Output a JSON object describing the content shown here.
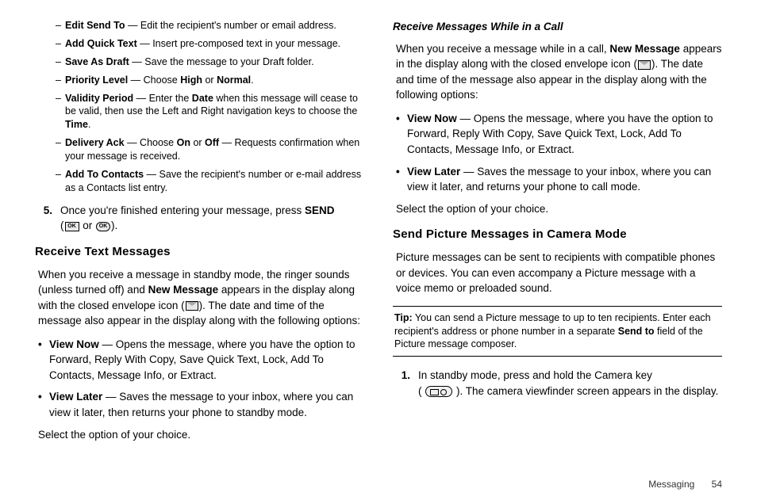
{
  "left": {
    "options": [
      {
        "title": "Edit Send To",
        "desc": " — Edit the recipient's number or email address."
      },
      {
        "title": "Add Quick Text",
        "desc": " — Insert pre-composed text in your message."
      },
      {
        "title": "Save As Draft",
        "desc": " — Save the message to your Draft folder."
      },
      {
        "title": "Priority Level",
        "desc_pre": " — Choose ",
        "b1": "High",
        "mid": " or ",
        "b2": "Normal",
        "post": "."
      },
      {
        "title": "Validity Period",
        "desc_pre": " — Enter the ",
        "b1": "Date",
        "mid": " when this message will cease to be valid, then use the Left and Right navigation keys to choose the ",
        "b2": "Time",
        "post": "."
      },
      {
        "title": "Delivery Ack",
        "desc_pre": " — Choose ",
        "b1": "On",
        "mid": " or ",
        "b2": "Off",
        "post": " — Requests confirmation when your message is received."
      },
      {
        "title": "Add To Contacts",
        "desc": " — Save the recipient's number or e-mail address as a Contacts list entry."
      }
    ],
    "step5": {
      "num": "5.",
      "pre": "Once you're finished entering your message, press ",
      "b": "SEND",
      "line2_open": "(",
      "line2_or": " or ",
      "line2_close": ")."
    },
    "h2": "Receive Text Messages",
    "para1_pre": "When you receive a message in standby mode, the ringer sounds (unless turned off) and ",
    "para1_b": "New Message",
    "para1_mid": " appears in the display along with the closed envelope icon (",
    "para1_post": "). The date and time of the message also appear in the display along with the following options:",
    "bullets": [
      {
        "b": "View Now",
        "t": " — Opens the message, where you have the option to Forward, Reply With Copy, Save Quick Text, Lock, Add To Contacts, Message Info, or Extract."
      },
      {
        "b": "View Later",
        "t": " — Saves the message to your inbox, where you can view it later, then returns your phone to standby mode."
      }
    ],
    "select": "Select the option of your choice."
  },
  "right": {
    "h3": "Receive Messages While in a Call",
    "p1_pre": "When you receive a message while in a call, ",
    "p1_b": "New Message",
    "p1_mid": " appears in the display along with the closed envelope icon (",
    "p1_post": "). The date and time of the message also appear in the display along with the following options:",
    "bullets": [
      {
        "b": "View Now",
        "t": " — Opens the message, where you have the option to Forward, Reply With Copy, Save Quick Text, Lock, Add To Contacts, Message Info, or Extract."
      },
      {
        "b": "View Later",
        "t": " — Saves the message to your inbox, where you can view it later, and returns your phone to call mode."
      }
    ],
    "select": "Select the option of your choice.",
    "h2": "Send Picture Messages in Camera Mode",
    "p2": "Picture messages can be sent to recipients with compatible phones or devices. You can even accompany a Picture message with a voice memo or preloaded sound.",
    "tip_label": "Tip:",
    "tip_pre": " You can send a Picture message to up to ten recipients. Enter each recipient's address or phone number in a separate ",
    "tip_b": "Send to",
    "tip_post": " field of the Picture message composer.",
    "step1": {
      "num": "1.",
      "l1": "In standby mode, press and hold the Camera key",
      "l2_open": "( ",
      "l2_close": " ). The camera viewfinder screen appears in the display."
    }
  },
  "footer": {
    "section": "Messaging",
    "page": "54"
  },
  "icons": {
    "ok": "OK",
    "okr": "OK"
  }
}
